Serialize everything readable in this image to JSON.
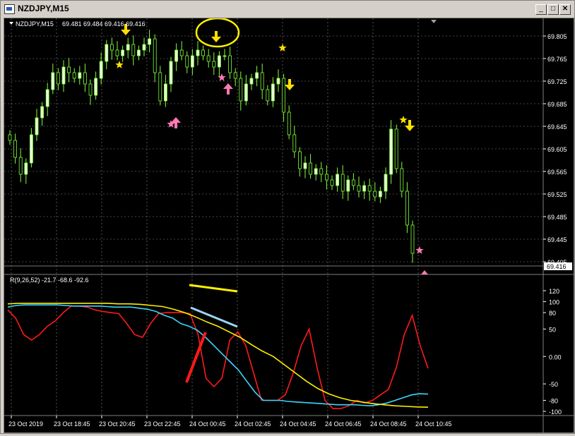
{
  "window": {
    "title": "NZDJPY,M15",
    "minimize_symbol": "_",
    "maximize_symbol": "□",
    "close_symbol": "✕"
  },
  "colors": {
    "background": "#000000",
    "grid": "#8a8a8a",
    "candle_body": "#e8ffd8",
    "candle_wick": "#7fff3a",
    "axis_text": "#ffffff",
    "rsi_red": "#ff1a1a",
    "cyan_line": "#3ad6ff",
    "yellow_line": "#ffef00",
    "signal_down": "#ffe000",
    "signal_up": "#ff78b4"
  },
  "main_chart": {
    "symbol_label": "NZDJPY,M15",
    "ohlc_label": "69.481 69.484 69.416 69.416",
    "current_price_label": "69.416",
    "price_axis": [
      "69.805",
      "69.765",
      "69.725",
      "69.685",
      "69.645",
      "69.605",
      "69.565",
      "69.525",
      "69.485",
      "69.445",
      "69.405"
    ],
    "time_axis": [
      "23 Oct 2019",
      "23 Oct 18:45",
      "23 Oct 20:45",
      "23 Oct 22:45",
      "24 Oct 00:45",
      "24 Oct 02:45",
      "24 Oct 04:45",
      "24 Oct 06:45",
      "24 Oct 08:45",
      "24 Oct 10:45"
    ]
  },
  "indicator": {
    "label": "R(9,26,52) -21.7 -68.6 -92.6",
    "axis": [
      "120",
      "100",
      "80",
      "50",
      "0.00",
      "-50",
      "-80",
      "-100"
    ]
  },
  "chart_data": [
    {
      "type": "candlestick",
      "title": "NZDJPY,M15",
      "ylim": [
        69.405,
        69.825
      ],
      "note_icons": [
        "arrow-down-yellow",
        "arrow-up-pink",
        "star-yellow",
        "star-pink"
      ],
      "closes": [
        69.62,
        69.59,
        69.56,
        69.58,
        69.63,
        69.66,
        69.68,
        69.71,
        69.74,
        69.72,
        69.75,
        69.74,
        69.73,
        69.74,
        69.72,
        69.7,
        69.73,
        69.76,
        69.79,
        69.78,
        69.77,
        69.78,
        69.79,
        69.77,
        69.78,
        69.79,
        69.8,
        69.74,
        69.69,
        69.72,
        69.76,
        69.78,
        69.77,
        69.75,
        69.77,
        69.78,
        69.77,
        69.76,
        69.75,
        69.77,
        69.77,
        69.74,
        69.73,
        69.69,
        69.72,
        69.73,
        69.74,
        69.71,
        69.69,
        69.72,
        69.73,
        69.67,
        69.63,
        69.6,
        69.57,
        69.58,
        69.56,
        69.57,
        69.56,
        69.55,
        69.54,
        69.56,
        69.53,
        69.55,
        69.54,
        69.53,
        69.54,
        69.53,
        69.52,
        69.53,
        69.56,
        69.64,
        69.57,
        69.53,
        69.47,
        69.42
      ]
    },
    {
      "type": "line",
      "ylim": [
        -100,
        120
      ],
      "series": [
        {
          "values": [
            85,
            70,
            40,
            30,
            40,
            55,
            65,
            80,
            92,
            92,
            90,
            85,
            82,
            80,
            78,
            60,
            40,
            35,
            60,
            78,
            80,
            80,
            80,
            78,
            40,
            -40,
            -55,
            -40,
            30,
            45,
            20,
            -30,
            -80,
            -80,
            -80,
            -70,
            -30,
            20,
            50,
            -20,
            -80,
            -95,
            -95,
            -90,
            -80,
            -85,
            -80,
            -70,
            -60,
            -20,
            40,
            75,
            20,
            -21.7
          ]
        },
        {
          "values": [
            90,
            93,
            94,
            94,
            94,
            94,
            94,
            93,
            92,
            92,
            92,
            92,
            91,
            90,
            90,
            90,
            88,
            86,
            82,
            75,
            70,
            60,
            55,
            48,
            35,
            20,
            5,
            -10,
            -25,
            -45,
            -65,
            -80,
            -80,
            -80,
            -82,
            -83,
            -84,
            -85,
            -86,
            -87,
            -88,
            -88,
            -88,
            -89,
            -90,
            -88,
            -85,
            -80,
            -75,
            -70,
            -68,
            -68.6
          ]
        },
        {
          "values": [
            96,
            97,
            97,
            97,
            97,
            97,
            97,
            97,
            97,
            97,
            96,
            96,
            95,
            93,
            91,
            86,
            80,
            72,
            63,
            55,
            45,
            35,
            22,
            10,
            0,
            -15,
            -30,
            -45,
            -58,
            -68,
            -75,
            -80,
            -83,
            -86,
            -88,
            -90,
            -91,
            -92,
            -92.6
          ]
        }
      ]
    }
  ]
}
